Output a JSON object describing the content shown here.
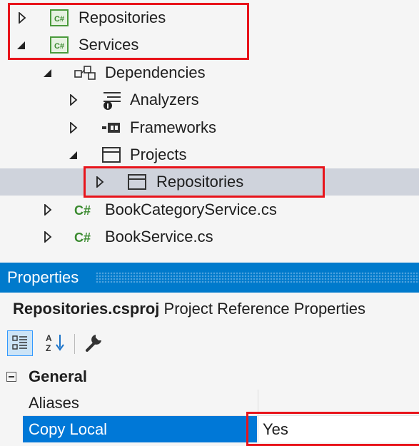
{
  "solution_tree": {
    "items": [
      {
        "label": "Repositories",
        "icon": "csharp-project-icon",
        "expanded": false
      },
      {
        "label": "Services",
        "icon": "csharp-project-icon",
        "expanded": true
      },
      {
        "label": "Dependencies",
        "icon": "dependencies-icon",
        "expanded": true
      },
      {
        "label": "Analyzers",
        "icon": "analyzers-icon",
        "expanded": false
      },
      {
        "label": "Frameworks",
        "icon": "frameworks-icon",
        "expanded": false
      },
      {
        "label": "Projects",
        "icon": "projects-icon",
        "expanded": true
      },
      {
        "label": "Repositories",
        "icon": "project-reference-icon",
        "expanded": false
      },
      {
        "label": "BookCategoryService.cs",
        "icon": "csharp-file-icon",
        "expanded": false
      },
      {
        "label": "BookService.cs",
        "icon": "csharp-file-icon",
        "expanded": false
      }
    ],
    "csharp_glyph": "C#"
  },
  "properties": {
    "title": "Properties",
    "object_name": "Repositories.csproj",
    "object_type": "Project Reference Properties",
    "toolbar": [
      "categorized-icon",
      "alphabetical-icon",
      "property-pages-icon"
    ],
    "category": "General",
    "rows": [
      {
        "name": "Aliases",
        "value": ""
      },
      {
        "name": "Copy Local",
        "value": "Yes"
      }
    ]
  },
  "colors": {
    "highlight_red": "#e8141b",
    "header_blue": "#007acc",
    "selection_blue": "#0078d7",
    "tree_selection": "#cfd3dc",
    "csharp_green": "#3a8a2f"
  }
}
